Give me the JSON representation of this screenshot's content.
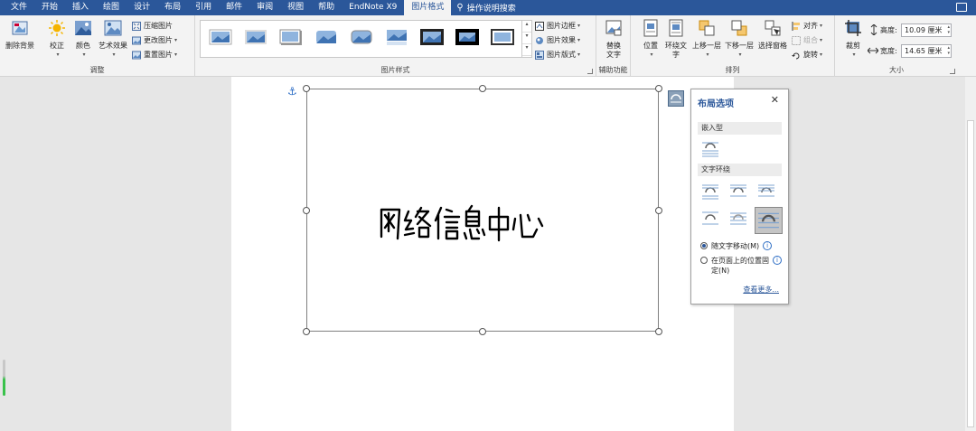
{
  "menu": {
    "tabs": [
      "文件",
      "开始",
      "插入",
      "绘图",
      "设计",
      "布局",
      "引用",
      "邮件",
      "审阅",
      "视图",
      "帮助",
      "EndNote X9",
      "图片格式"
    ],
    "active_tab": "图片格式",
    "tell_me": "操作说明搜索"
  },
  "ribbon": {
    "adjust": {
      "remove_bg": "删除背景",
      "correct": "校正",
      "color": "颜色",
      "artistic": "艺术效果",
      "compress": "压缩图片",
      "change": "更改图片",
      "reset": "重置图片",
      "label": "调整"
    },
    "styles": {
      "border": "图片边框",
      "effects": "图片效果",
      "layout": "图片版式",
      "label": "图片样式"
    },
    "accessibility": {
      "alt_text_line1": "替换",
      "alt_text_line2": "文字",
      "label": "辅助功能"
    },
    "arrange": {
      "position": "位置",
      "wrap_line1": "环绕文",
      "wrap_line2": "字",
      "forward": "上移一层",
      "backward": "下移一层",
      "selection_pane": "选择窗格",
      "align": "对齐",
      "group": "组合",
      "rotate": "旋转",
      "label": "排列"
    },
    "size": {
      "crop": "裁剪",
      "height_label": "高度:",
      "height_value": "10.09 厘米",
      "width_label": "宽度:",
      "width_value": "14.65 厘米",
      "label": "大小"
    }
  },
  "document": {
    "image_text": "网络信息中心"
  },
  "layout_popup": {
    "title": "布局选项",
    "inline_section": "嵌入型",
    "wrap_section": "文字环绕",
    "move_with_text": "随文字移动(M)",
    "fix_position": "在页面上的位置固定(N)",
    "see_more": "查看更多..."
  },
  "colors": {
    "accent": "#2b579a",
    "ribbon_bg": "#f3f3f3",
    "doc_bg": "#e6e6e6"
  }
}
